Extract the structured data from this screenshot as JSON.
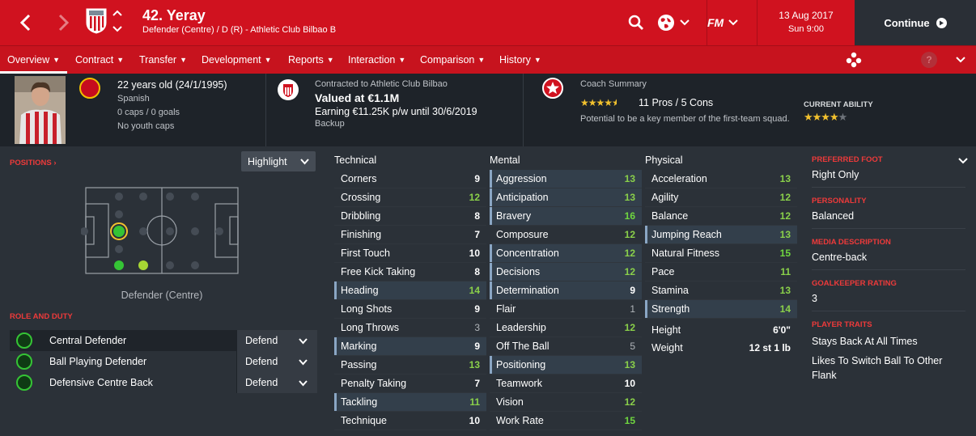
{
  "header": {
    "title": "42. Yeray",
    "subtitle": "Defender (Centre) / D (R) - Athletic Club Bilbao B",
    "date": "13 Aug 2017",
    "time": "Sun 9:00",
    "continue_label": "Continue",
    "fm_label": "FM"
  },
  "nav": {
    "tabs": [
      "Overview",
      "Contract",
      "Transfer",
      "Development",
      "Reports",
      "Interaction",
      "Comparison",
      "History"
    ],
    "help_label": "?"
  },
  "info": {
    "age": "22 years old (24/1/1995)",
    "nationality": "Spanish",
    "caps": "0 caps / 0 goals",
    "youth": "No youth caps",
    "contract_label": "Contracted to Athletic Club Bilbao",
    "value": "Valued at €1.1M",
    "earning": "Earning €11.25K p/w until 30/6/2019",
    "status": "Backup",
    "coach_label": "Coach Summary",
    "coach_stars": 4.5,
    "coach_pros": "11 Pros / 5 Cons",
    "coach_note": "Potential to be a key member of the first-team squad.",
    "ca_label": "CURRENT ABILITY",
    "ca_stars": 4
  },
  "positions": {
    "title": "POSITIONS",
    "highlight_label": "Highlight",
    "position_label": "Defender (Centre)",
    "role_title": "ROLE AND DUTY",
    "roles": [
      {
        "name": "Central Defender",
        "duty": "Defend"
      },
      {
        "name": "Ball Playing Defender",
        "duty": "Defend"
      },
      {
        "name": "Defensive Centre Back",
        "duty": "Defend"
      }
    ]
  },
  "attributes": {
    "technical_label": "Technical",
    "mental_label": "Mental",
    "physical_label": "Physical",
    "technical": [
      {
        "name": "Corners",
        "value": 9,
        "hl": false
      },
      {
        "name": "Crossing",
        "value": 12,
        "hl": false
      },
      {
        "name": "Dribbling",
        "value": 8,
        "hl": false
      },
      {
        "name": "Finishing",
        "value": 7,
        "hl": false
      },
      {
        "name": "First Touch",
        "value": 10,
        "hl": false
      },
      {
        "name": "Free Kick Taking",
        "value": 8,
        "hl": false
      },
      {
        "name": "Heading",
        "value": 14,
        "hl": true
      },
      {
        "name": "Long Shots",
        "value": 9,
        "hl": false
      },
      {
        "name": "Long Throws",
        "value": 3,
        "hl": false
      },
      {
        "name": "Marking",
        "value": 9,
        "hl": true
      },
      {
        "name": "Passing",
        "value": 13,
        "hl": false
      },
      {
        "name": "Penalty Taking",
        "value": 7,
        "hl": false
      },
      {
        "name": "Tackling",
        "value": 11,
        "hl": true
      },
      {
        "name": "Technique",
        "value": 10,
        "hl": false
      }
    ],
    "mental": [
      {
        "name": "Aggression",
        "value": 13,
        "hl": true
      },
      {
        "name": "Anticipation",
        "value": 13,
        "hl": true
      },
      {
        "name": "Bravery",
        "value": 16,
        "hl": true
      },
      {
        "name": "Composure",
        "value": 12,
        "hl": false
      },
      {
        "name": "Concentration",
        "value": 12,
        "hl": true
      },
      {
        "name": "Decisions",
        "value": 12,
        "hl": true
      },
      {
        "name": "Determination",
        "value": 9,
        "hl": true
      },
      {
        "name": "Flair",
        "value": 1,
        "hl": false
      },
      {
        "name": "Leadership",
        "value": 12,
        "hl": false
      },
      {
        "name": "Off The Ball",
        "value": 5,
        "hl": false
      },
      {
        "name": "Positioning",
        "value": 13,
        "hl": true
      },
      {
        "name": "Teamwork",
        "value": 10,
        "hl": false
      },
      {
        "name": "Vision",
        "value": 12,
        "hl": false
      },
      {
        "name": "Work Rate",
        "value": 15,
        "hl": false
      }
    ],
    "physical": [
      {
        "name": "Acceleration",
        "value": 13,
        "hl": false
      },
      {
        "name": "Agility",
        "value": 12,
        "hl": false
      },
      {
        "name": "Balance",
        "value": 12,
        "hl": false
      },
      {
        "name": "Jumping Reach",
        "value": 13,
        "hl": true
      },
      {
        "name": "Natural Fitness",
        "value": 15,
        "hl": false
      },
      {
        "name": "Pace",
        "value": 11,
        "hl": false
      },
      {
        "name": "Stamina",
        "value": 13,
        "hl": false
      },
      {
        "name": "Strength",
        "value": 14,
        "hl": true
      }
    ],
    "height_label": "Height",
    "height": "6'0\"",
    "weight_label": "Weight",
    "weight": "12 st 1 lb"
  },
  "sidebar": {
    "foot_title": "PREFERRED FOOT",
    "foot": "Right Only",
    "personality_title": "PERSONALITY",
    "personality": "Balanced",
    "media_title": "MEDIA DESCRIPTION",
    "media": "Centre-back",
    "gk_title": "GOALKEEPER RATING",
    "gk": "3",
    "traits_title": "PLAYER TRAITS",
    "traits": [
      "Stays Back At All Times",
      "Likes To Switch Ball To Other Flank"
    ]
  },
  "colors": {
    "brand": "#d0121f",
    "value_high": "#6fd63f",
    "star": "#f2c12e"
  }
}
